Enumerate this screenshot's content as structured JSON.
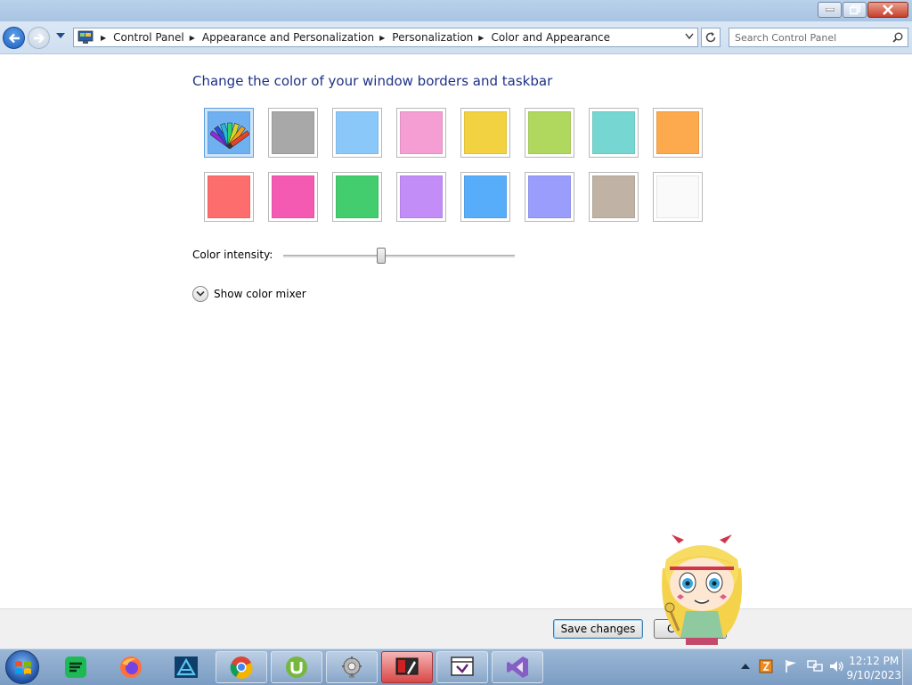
{
  "address_bar": {
    "breadcrumbs": [
      "Control Panel",
      "Appearance and Personalization",
      "Personalization",
      "Color and Appearance"
    ]
  },
  "search": {
    "placeholder": "Search Control Panel"
  },
  "content": {
    "heading": "Change the color of your window borders and taskbar",
    "swatches": [
      {
        "name": "Custom",
        "color": "#6fb0f0",
        "icon": "color-fan-icon",
        "selected": true
      },
      {
        "name": "Slate",
        "color": "#a8a8a8"
      },
      {
        "name": "Sky",
        "color": "#8ac8fa"
      },
      {
        "name": "Blush",
        "color": "#f49ed4"
      },
      {
        "name": "Gold",
        "color": "#f3d241"
      },
      {
        "name": "Leaf",
        "color": "#b0d85e"
      },
      {
        "name": "Teal",
        "color": "#76d7d2"
      },
      {
        "name": "Pumpkin",
        "color": "#fda94e"
      },
      {
        "name": "Red",
        "color": "#fe6d6d"
      },
      {
        "name": "Fuchsia",
        "color": "#f55ab2"
      },
      {
        "name": "Green",
        "color": "#44cd6f"
      },
      {
        "name": "Violet",
        "color": "#c38df8"
      },
      {
        "name": "Blue",
        "color": "#57adf9"
      },
      {
        "name": "Lavender",
        "color": "#9a9dfb"
      },
      {
        "name": "Taupe",
        "color": "#c0b3a6"
      },
      {
        "name": "Frost",
        "color": "#fafafa"
      }
    ],
    "intensity_label": "Color intensity:",
    "intensity_value": 0.42,
    "mixer_label": "Show color mixer"
  },
  "buttons": {
    "save": "Save changes",
    "cancel": "C"
  },
  "taskbar": {
    "items": [
      {
        "name": "taskbar-spotify",
        "icon": "spotify-icon"
      },
      {
        "name": "taskbar-firefox",
        "icon": "firefox-icon"
      },
      {
        "name": "taskbar-altair",
        "icon": "altair-icon"
      },
      {
        "name": "taskbar-chrome",
        "icon": "chrome-icon"
      },
      {
        "name": "taskbar-utorrent",
        "icon": "utorrent-icon"
      },
      {
        "name": "taskbar-system-tool",
        "icon": "gear-tool-icon"
      },
      {
        "name": "taskbar-personalization",
        "icon": "personalization-icon"
      },
      {
        "name": "taskbar-vs-remote",
        "icon": "vs-remote-icon"
      },
      {
        "name": "taskbar-visual-studio",
        "icon": "visual-studio-icon"
      }
    ],
    "clock_time": "12:12 PM",
    "clock_date": "9/10/2023"
  },
  "colors": {
    "accent": "#1e3287",
    "titlebar": "#b9d1ea",
    "taskbar": "#8aa9cd"
  }
}
